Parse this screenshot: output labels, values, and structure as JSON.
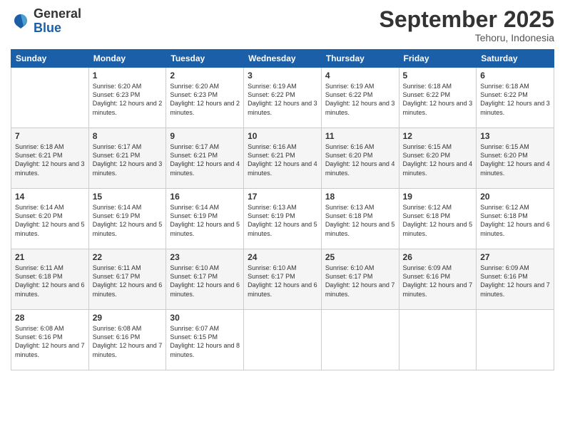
{
  "header": {
    "logo_general": "General",
    "logo_blue": "Blue",
    "month": "September 2025",
    "location": "Tehoru, Indonesia"
  },
  "days_of_week": [
    "Sunday",
    "Monday",
    "Tuesday",
    "Wednesday",
    "Thursday",
    "Friday",
    "Saturday"
  ],
  "weeks": [
    [
      {
        "day": "",
        "content": ""
      },
      {
        "day": "1",
        "content": "Sunrise: 6:20 AM\nSunset: 6:23 PM\nDaylight: 12 hours\nand 2 minutes."
      },
      {
        "day": "2",
        "content": "Sunrise: 6:20 AM\nSunset: 6:23 PM\nDaylight: 12 hours\nand 2 minutes."
      },
      {
        "day": "3",
        "content": "Sunrise: 6:19 AM\nSunset: 6:22 PM\nDaylight: 12 hours\nand 3 minutes."
      },
      {
        "day": "4",
        "content": "Sunrise: 6:19 AM\nSunset: 6:22 PM\nDaylight: 12 hours\nand 3 minutes."
      },
      {
        "day": "5",
        "content": "Sunrise: 6:18 AM\nSunset: 6:22 PM\nDaylight: 12 hours\nand 3 minutes."
      },
      {
        "day": "6",
        "content": "Sunrise: 6:18 AM\nSunset: 6:22 PM\nDaylight: 12 hours\nand 3 minutes."
      }
    ],
    [
      {
        "day": "7",
        "content": "Sunrise: 6:18 AM\nSunset: 6:21 PM\nDaylight: 12 hours\nand 3 minutes."
      },
      {
        "day": "8",
        "content": "Sunrise: 6:17 AM\nSunset: 6:21 PM\nDaylight: 12 hours\nand 3 minutes."
      },
      {
        "day": "9",
        "content": "Sunrise: 6:17 AM\nSunset: 6:21 PM\nDaylight: 12 hours\nand 4 minutes."
      },
      {
        "day": "10",
        "content": "Sunrise: 6:16 AM\nSunset: 6:21 PM\nDaylight: 12 hours\nand 4 minutes."
      },
      {
        "day": "11",
        "content": "Sunrise: 6:16 AM\nSunset: 6:20 PM\nDaylight: 12 hours\nand 4 minutes."
      },
      {
        "day": "12",
        "content": "Sunrise: 6:15 AM\nSunset: 6:20 PM\nDaylight: 12 hours\nand 4 minutes."
      },
      {
        "day": "13",
        "content": "Sunrise: 6:15 AM\nSunset: 6:20 PM\nDaylight: 12 hours\nand 4 minutes."
      }
    ],
    [
      {
        "day": "14",
        "content": "Sunrise: 6:14 AM\nSunset: 6:20 PM\nDaylight: 12 hours\nand 5 minutes."
      },
      {
        "day": "15",
        "content": "Sunrise: 6:14 AM\nSunset: 6:19 PM\nDaylight: 12 hours\nand 5 minutes."
      },
      {
        "day": "16",
        "content": "Sunrise: 6:14 AM\nSunset: 6:19 PM\nDaylight: 12 hours\nand 5 minutes."
      },
      {
        "day": "17",
        "content": "Sunrise: 6:13 AM\nSunset: 6:19 PM\nDaylight: 12 hours\nand 5 minutes."
      },
      {
        "day": "18",
        "content": "Sunrise: 6:13 AM\nSunset: 6:18 PM\nDaylight: 12 hours\nand 5 minutes."
      },
      {
        "day": "19",
        "content": "Sunrise: 6:12 AM\nSunset: 6:18 PM\nDaylight: 12 hours\nand 5 minutes."
      },
      {
        "day": "20",
        "content": "Sunrise: 6:12 AM\nSunset: 6:18 PM\nDaylight: 12 hours\nand 6 minutes."
      }
    ],
    [
      {
        "day": "21",
        "content": "Sunrise: 6:11 AM\nSunset: 6:18 PM\nDaylight: 12 hours\nand 6 minutes."
      },
      {
        "day": "22",
        "content": "Sunrise: 6:11 AM\nSunset: 6:17 PM\nDaylight: 12 hours\nand 6 minutes."
      },
      {
        "day": "23",
        "content": "Sunrise: 6:10 AM\nSunset: 6:17 PM\nDaylight: 12 hours\nand 6 minutes."
      },
      {
        "day": "24",
        "content": "Sunrise: 6:10 AM\nSunset: 6:17 PM\nDaylight: 12 hours\nand 6 minutes."
      },
      {
        "day": "25",
        "content": "Sunrise: 6:10 AM\nSunset: 6:17 PM\nDaylight: 12 hours\nand 7 minutes."
      },
      {
        "day": "26",
        "content": "Sunrise: 6:09 AM\nSunset: 6:16 PM\nDaylight: 12 hours\nand 7 minutes."
      },
      {
        "day": "27",
        "content": "Sunrise: 6:09 AM\nSunset: 6:16 PM\nDaylight: 12 hours\nand 7 minutes."
      }
    ],
    [
      {
        "day": "28",
        "content": "Sunrise: 6:08 AM\nSunset: 6:16 PM\nDaylight: 12 hours\nand 7 minutes."
      },
      {
        "day": "29",
        "content": "Sunrise: 6:08 AM\nSunset: 6:16 PM\nDaylight: 12 hours\nand 7 minutes."
      },
      {
        "day": "30",
        "content": "Sunrise: 6:07 AM\nSunset: 6:15 PM\nDaylight: 12 hours\nand 8 minutes."
      },
      {
        "day": "",
        "content": ""
      },
      {
        "day": "",
        "content": ""
      },
      {
        "day": "",
        "content": ""
      },
      {
        "day": "",
        "content": ""
      }
    ]
  ]
}
